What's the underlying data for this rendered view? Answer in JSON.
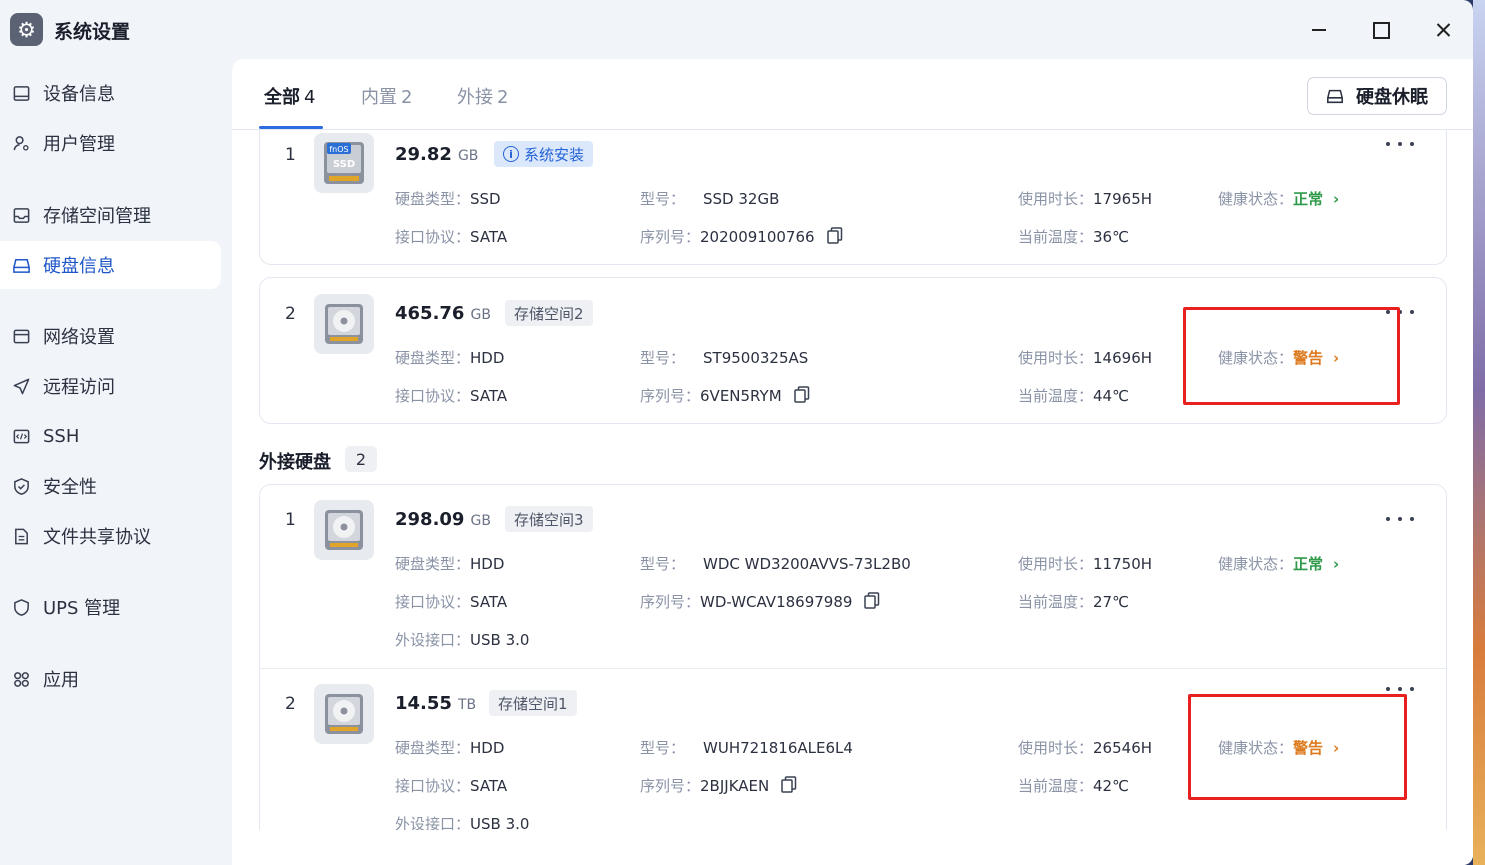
{
  "window": {
    "title": "系统设置"
  },
  "sidebar": {
    "items": [
      {
        "label": "设备信息",
        "icon": "device-icon"
      },
      {
        "label": "用户管理",
        "icon": "user-icon"
      },
      {
        "label": "存储空间管理",
        "icon": "storage-icon"
      },
      {
        "label": "硬盘信息",
        "icon": "disk-icon",
        "active": true
      },
      {
        "label": "网络设置",
        "icon": "network-icon"
      },
      {
        "label": "远程访问",
        "icon": "send-icon"
      },
      {
        "label": "SSH",
        "icon": "code-icon"
      },
      {
        "label": "安全性",
        "icon": "shield-check-icon"
      },
      {
        "label": "文件共享协议",
        "icon": "document-icon"
      },
      {
        "label": "UPS 管理",
        "icon": "shield-icon"
      },
      {
        "label": "应用",
        "icon": "apps-icon"
      }
    ]
  },
  "tabs": [
    {
      "label": "全部",
      "count": "4",
      "active": true
    },
    {
      "label": "内置",
      "count": "2"
    },
    {
      "label": "外接",
      "count": "2"
    }
  ],
  "sleep_button": "硬盘休眠",
  "labels": {
    "type": "硬盘类型：",
    "model": "型号：",
    "hours": "使用时长：",
    "health": "健康状态：",
    "iface": "接口协议：",
    "serial": "序列号：",
    "temp": "当前温度：",
    "port": "外设接口："
  },
  "external_section": {
    "title": "外接硬盘",
    "count": "2"
  },
  "disks": [
    {
      "index": "1",
      "size": "29.82",
      "unit": "GB",
      "tag": "系统安装",
      "type": "SSD",
      "model": "SSD 32GB",
      "hours": "17965H",
      "health": "正常",
      "iface": "SATA",
      "serial": "202009100766",
      "temp": "36℃",
      "icon_badge": "fnOS",
      "icon_text": "SSD"
    },
    {
      "index": "2",
      "size": "465.76",
      "unit": "GB",
      "tag": "存储空间2",
      "type": "HDD",
      "model": "ST9500325AS",
      "hours": "14696H",
      "health": "警告",
      "iface": "SATA",
      "serial": "6VEN5RYM",
      "temp": "44℃"
    },
    {
      "index": "1",
      "size": "298.09",
      "unit": "GB",
      "tag": "存储空间3",
      "type": "HDD",
      "model": "WDC WD3200AVVS-73L2B0",
      "hours": "11750H",
      "health": "正常",
      "iface": "SATA",
      "serial": "WD-WCAV18697989",
      "temp": "27℃",
      "port": "USB 3.0"
    },
    {
      "index": "2",
      "size": "14.55",
      "unit": "TB",
      "tag": "存储空间1",
      "type": "HDD",
      "model": "WUH721816ALE6L4",
      "hours": "26546H",
      "health": "警告",
      "iface": "SATA",
      "serial": "2BJJKAEN",
      "temp": "42℃",
      "port": "USB 3.0"
    }
  ],
  "colors": {
    "accent": "#2d6be0",
    "ok": "#2e9a4a",
    "warn": "#dc7a1d",
    "highlight": "#e8201f"
  }
}
